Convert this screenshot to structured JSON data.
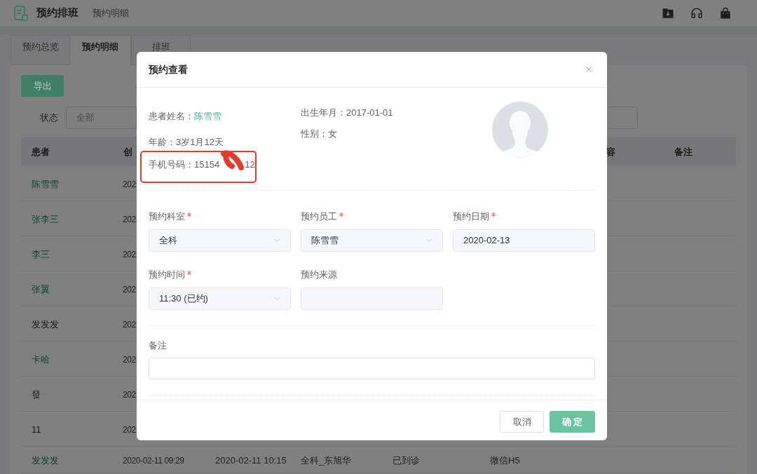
{
  "app_header": {
    "title": "预约排班",
    "breadcrumb": "预约明细"
  },
  "tabs": [
    {
      "label": "预约总览",
      "selected": false
    },
    {
      "label": "预约明细",
      "selected": true
    },
    {
      "label": "排班",
      "selected": false
    }
  ],
  "export_button": {
    "label": "导出"
  },
  "filters": {
    "status_label": "状态",
    "status_placeholder": "全部"
  },
  "table": {
    "columns": [
      {
        "label": "患者"
      },
      {
        "label": "创"
      },
      {},
      {},
      {},
      {},
      {
        "label": "容"
      },
      {
        "label": "备注"
      }
    ],
    "rows": [
      {
        "cells": [
          "陈雪雪",
          "202"
        ],
        "linked": true
      },
      {
        "cells": [
          "张李三",
          "202"
        ],
        "linked": true
      },
      {
        "cells": [
          "李三",
          "202"
        ],
        "linked": true
      },
      {
        "cells": [
          "张翼",
          "202"
        ],
        "linked": true
      },
      {
        "cells": [
          "发发发",
          "202"
        ],
        "linked": false
      },
      {
        "cells": [
          "卡哈",
          "202"
        ],
        "linked": true
      },
      {
        "cells": [
          "發",
          "202"
        ],
        "linked": false
      },
      {
        "cells": [
          "11",
          "202"
        ],
        "linked": false
      },
      {
        "cells": [
          "发发发",
          "2020-02-11 09:29",
          "2020-02-11 10:15",
          "全科_东旭华",
          "已到诊",
          "微信H5"
        ],
        "linked": true
      }
    ]
  },
  "dialog": {
    "title": "预约查看",
    "patient": {
      "name_label": "患者姓名：",
      "name": "陈雪雪",
      "age": "年龄：3岁1月12天",
      "phone_label": "手机号码：",
      "phone_start": "15154",
      "phone_end": "12",
      "birth": "出生年月：2017-01-01",
      "gender": "性别：女"
    },
    "fields": [
      {
        "label": "预约科室",
        "required": true,
        "kind": "select",
        "value": "全科"
      },
      {
        "label": "预约员工",
        "required": true,
        "kind": "select",
        "value": "陈雪雪"
      },
      {
        "label": "预约日期",
        "required": true,
        "kind": "input",
        "value": "2020-02-13"
      },
      {
        "label": "预约时间",
        "required": true,
        "kind": "select",
        "value": "11:30 (已约)"
      },
      {
        "label": "预约来源",
        "required": false,
        "kind": "input"
      }
    ],
    "note": {
      "label": "备注"
    },
    "buttons": [
      {
        "label": "取消",
        "kind": "secondary"
      },
      {
        "label": "确 定",
        "kind": "primary"
      }
    ]
  }
}
